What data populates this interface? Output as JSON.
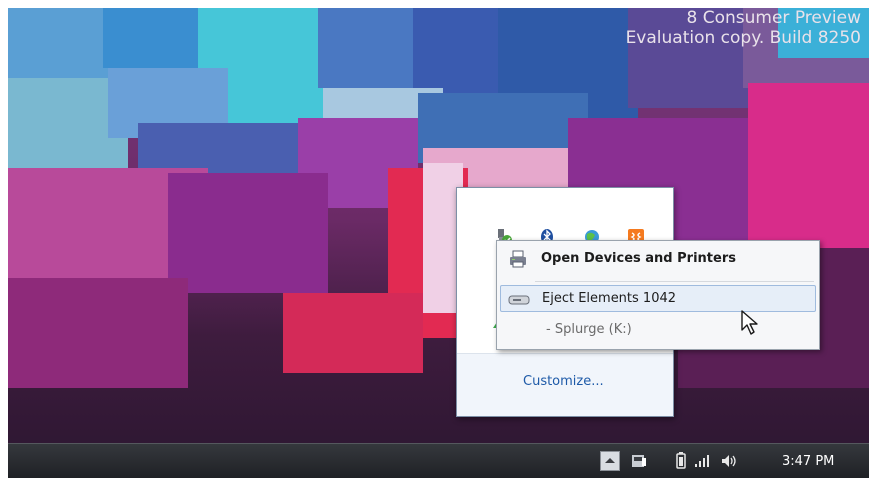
{
  "desktop": {
    "watermark_line1": "8 Consumer Preview",
    "watermark_line2": "Evaluation copy. Build 8250"
  },
  "tray_flyout": {
    "icons": [
      "usb-device-icon",
      "bluetooth-icon",
      "network-globe-icon",
      "xampp-icon",
      "briefcase-icon",
      "sync-icon"
    ],
    "customize_label": "Customize..."
  },
  "context_menu": {
    "open_devices_label": "Open Devices and Printers",
    "eject_label": "Eject Elements 1042",
    "drive_label": "- Splurge (K:)"
  },
  "taskbar": {
    "tray_icons": [
      "show-hidden-icons-chevron",
      "action-center-icon",
      "battery-icon",
      "signal-icon",
      "volume-icon"
    ],
    "clock": "3:47 PM"
  },
  "colors": {
    "link": "#1e5aa8",
    "menu_highlight": "#e6eef8",
    "taskbar": "#26282c"
  }
}
